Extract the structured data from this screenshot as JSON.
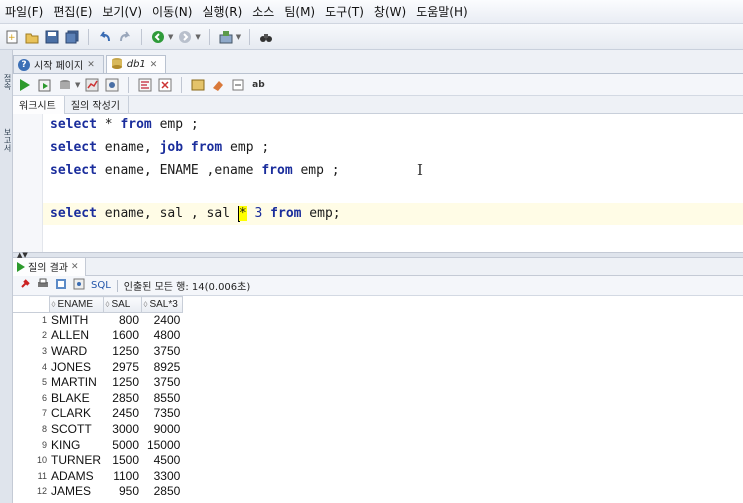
{
  "menu": [
    "파일(F)",
    "편집(E)",
    "보기(V)",
    "이동(N)",
    "실행(R)",
    "소스",
    "팀(M)",
    "도구(T)",
    "창(W)",
    "도움말(H)"
  ],
  "left_strip": {
    "tab1": "접속",
    "tab2": "보고서"
  },
  "editor_tabs": [
    {
      "label": "시작 페이지",
      "icon": "help-circle-icon"
    },
    {
      "label": "db1",
      "icon": "database-icon"
    }
  ],
  "sub_tabs": [
    "워크시트",
    "질의 작성기"
  ],
  "code": {
    "line1": {
      "kw1": "select",
      "p1": " * ",
      "kw2": "from",
      "p2": " emp ;"
    },
    "line2": {
      "kw1": "select",
      "p1": " ename, ",
      "kw2": "job",
      "p2": " ",
      "kw3": "from",
      "p3": " emp ;"
    },
    "line3": {
      "kw1": "select",
      "p1": " ename, ENAME ,ename ",
      "kw2": "from",
      "p2": " emp ;"
    },
    "line4": {
      "kw1": "select",
      "p1": " ename, sal , sal ",
      "star": "*",
      "p2": " ",
      "num": "3",
      "p3": " ",
      "kw2": "from",
      "p4": " emp;"
    }
  },
  "results": {
    "tab_label": "질의 결과",
    "sql_label": "SQL",
    "status": "인출된 모든 행: 14(0.006초)",
    "columns": [
      "ENAME",
      "SAL",
      "SAL*3"
    ],
    "rows": [
      {
        "n": "1",
        "ename": "SMITH",
        "sal": "800",
        "sal3": "2400"
      },
      {
        "n": "2",
        "ename": "ALLEN",
        "sal": "1600",
        "sal3": "4800"
      },
      {
        "n": "3",
        "ename": "WARD",
        "sal": "1250",
        "sal3": "3750"
      },
      {
        "n": "4",
        "ename": "JONES",
        "sal": "2975",
        "sal3": "8925"
      },
      {
        "n": "5",
        "ename": "MARTIN",
        "sal": "1250",
        "sal3": "3750"
      },
      {
        "n": "6",
        "ename": "BLAKE",
        "sal": "2850",
        "sal3": "8550"
      },
      {
        "n": "7",
        "ename": "CLARK",
        "sal": "2450",
        "sal3": "7350"
      },
      {
        "n": "8",
        "ename": "SCOTT",
        "sal": "3000",
        "sal3": "9000"
      },
      {
        "n": "9",
        "ename": "KING",
        "sal": "5000",
        "sal3": "15000"
      },
      {
        "n": "10",
        "ename": "TURNER",
        "sal": "1500",
        "sal3": "4500"
      },
      {
        "n": "11",
        "ename": "ADAMS",
        "sal": "1100",
        "sal3": "3300"
      },
      {
        "n": "12",
        "ename": "JAMES",
        "sal": "950",
        "sal3": "2850"
      }
    ]
  },
  "colors": {
    "keyword": "#1a2d9c",
    "highlight": "#ffff00",
    "run_green": "#2d9a2d"
  }
}
